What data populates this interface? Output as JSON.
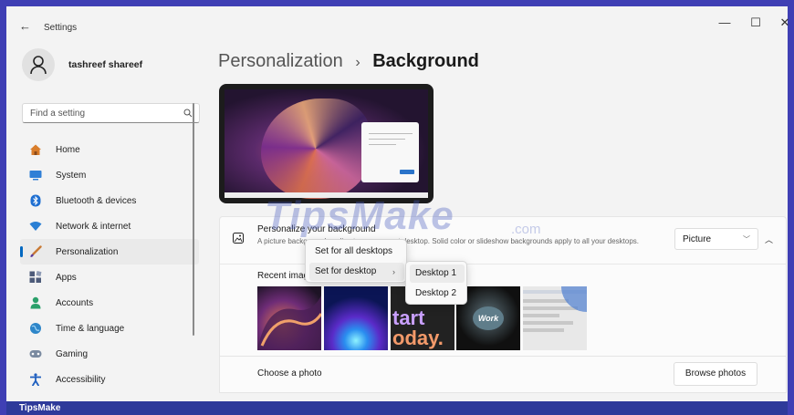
{
  "window": {
    "title": "Settings",
    "back": "←",
    "minimize": "—",
    "maximize": "☐",
    "close": "✕"
  },
  "user": {
    "name": "tashreef shareef"
  },
  "search": {
    "placeholder": "Find a setting"
  },
  "nav": [
    {
      "label": "Home",
      "icon": "home-icon",
      "color": "#d97d2b"
    },
    {
      "label": "System",
      "icon": "monitor-icon",
      "color": "#2f7fd6"
    },
    {
      "label": "Bluetooth & devices",
      "icon": "bluetooth-icon",
      "color": "#1f6fd1"
    },
    {
      "label": "Network & internet",
      "icon": "wifi-icon",
      "color": "#2a7fd4"
    },
    {
      "label": "Personalization",
      "icon": "brush-icon",
      "color": "#c97a35",
      "active": true
    },
    {
      "label": "Apps",
      "icon": "apps-icon",
      "color": "#4d5b7a"
    },
    {
      "label": "Accounts",
      "icon": "person-icon",
      "color": "#2aa06a"
    },
    {
      "label": "Time & language",
      "icon": "globe-icon",
      "color": "#2e86c9"
    },
    {
      "label": "Gaming",
      "icon": "gamepad-icon",
      "color": "#7a8aa0"
    },
    {
      "label": "Accessibility",
      "icon": "accessibility-icon",
      "color": "#1f5fbf"
    }
  ],
  "breadcrumb": {
    "parent": "Personalization",
    "separator": "›",
    "current": "Background"
  },
  "background_card": {
    "title": "Personalize your background",
    "description": "A picture background applies to your current desktop. Solid color or slideshow backgrounds apply to all your desktops.",
    "dropdown_value": "Picture",
    "recent_label": "Recent images",
    "thumb3_line1": "tart",
    "thumb3_line2": "oday.",
    "thumb4_label": "Work"
  },
  "photo_row": {
    "label": "Choose a photo",
    "button": "Browse photos"
  },
  "context_menu": {
    "items": [
      "Set for all desktops",
      "Set for desktop"
    ],
    "submenu_arrow": "›",
    "submenu": [
      "Desktop 1",
      "Desktop 2"
    ]
  },
  "watermark": {
    "text": "TipsMake",
    "suffix": ".com"
  },
  "footer": {
    "brand": "TipsMake"
  },
  "colors": {
    "accent": "#0067c0",
    "frame": "#3f3fb4",
    "footer": "#2e3a9a"
  }
}
